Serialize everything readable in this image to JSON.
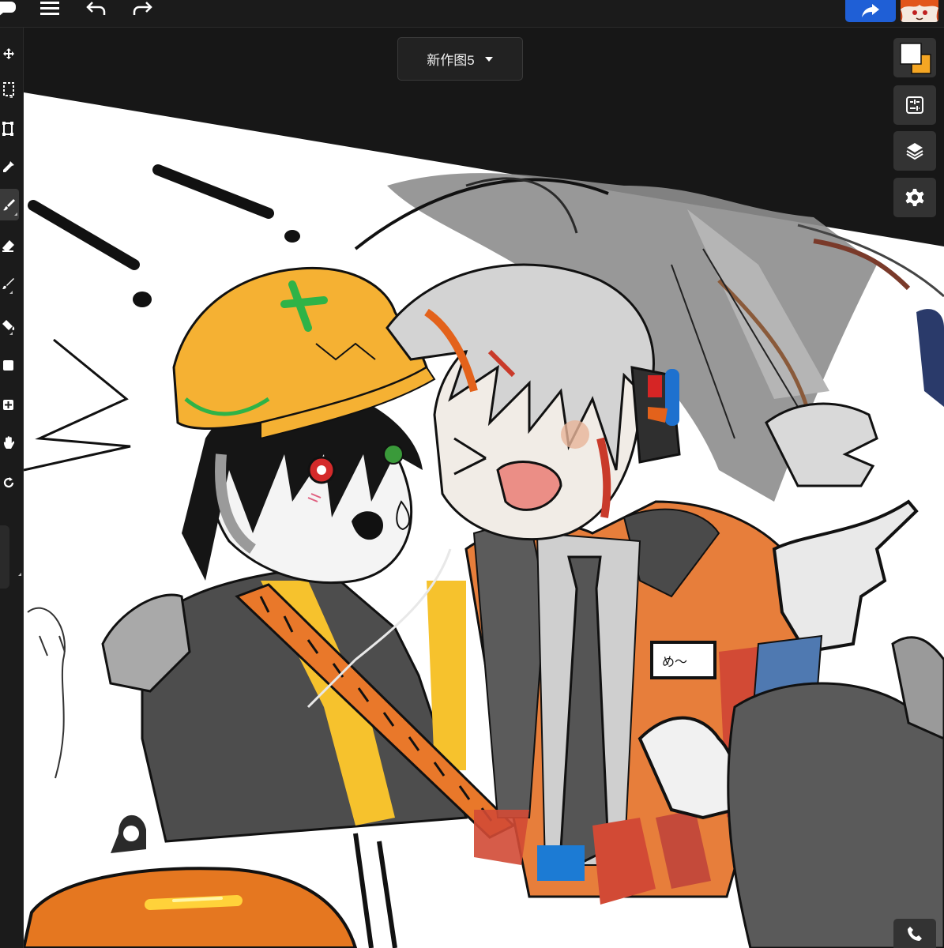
{
  "document": {
    "title": "新作图5"
  },
  "colors": {
    "primary_color": "#ffffff",
    "secondary_color": "#f5a623",
    "share_button": "#1f5fd6",
    "ui_background": "#1b1b1b"
  },
  "toolbar": {
    "left_icons": [
      "chat-icon",
      "menu-icon",
      "undo-icon",
      "redo-icon"
    ],
    "right_icons": [
      "share-icon",
      "avatar"
    ]
  },
  "tools": [
    "move-tool-icon",
    "selection-tool-icon",
    "transform-tool-icon",
    "eyedropper-tool-icon",
    "brush-tool-icon",
    "eraser-tool-icon",
    "smudge-tool-icon",
    "fill-tool-icon",
    "shape-tool-icon",
    "add-tool-icon",
    "hand-tool-icon",
    "rotate-tool-icon"
  ],
  "active_tool": "brush-tool-icon",
  "right_panel": [
    "color-picker-button",
    "adjustments-icon",
    "layers-icon",
    "settings-icon",
    "phone-icon"
  ]
}
